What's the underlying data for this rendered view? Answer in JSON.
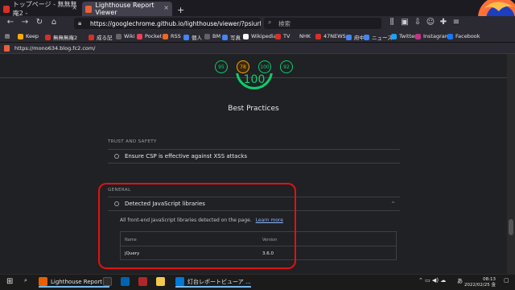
{
  "tabs": [
    {
      "label": "トップページ - 無無無庵2 -",
      "close": "×",
      "icon_color": "#d93025"
    },
    {
      "label": "Lighthouse Report Viewer",
      "close": "×",
      "icon_color": "#e8613c"
    }
  ],
  "new_tab": "+",
  "nav": {
    "back": "←",
    "forward": "→",
    "reload": "↻",
    "home": "⌂"
  },
  "address": {
    "url": "https://googlechrome.github.io/lighthouse/viewer/?psiurl=htt"
  },
  "search": {
    "placeholder": "検索"
  },
  "bookmarks": [
    {
      "label": "Keep",
      "color": "#f9ab00"
    },
    {
      "label": "無無無庵2",
      "color": "#d93025"
    },
    {
      "label": "成る記",
      "color": "#d93025"
    },
    {
      "label": "Wiki",
      "color": "#666666"
    },
    {
      "label": "Pocket",
      "color": "#ef4056"
    },
    {
      "label": "RSS",
      "color": "#f26522"
    },
    {
      "label": "個人",
      "color": "#4285f4"
    },
    {
      "label": "BM",
      "color": "#5f6368"
    },
    {
      "label": "写真",
      "color": "#4285f4"
    },
    {
      "label": "Wikipedia",
      "color": "#ffffff"
    },
    {
      "label": "TV",
      "color": "#d93025"
    },
    {
      "label": "NHK",
      "color": "#cccccc"
    },
    {
      "label": "47NEWS",
      "color": "#d93025"
    },
    {
      "label": "府中",
      "color": "#4285f4"
    },
    {
      "label": "ニュース",
      "color": "#4285f4"
    },
    {
      "label": "Twitter",
      "color": "#1da1f2"
    },
    {
      "label": "Instagram",
      "color": "#c13584"
    },
    {
      "label": "Facebook",
      "color": "#1877f2"
    }
  ],
  "site": {
    "url": "https://mono634.blog.fc2.com/"
  },
  "scores": [
    {
      "value": "95",
      "rating": "green"
    },
    {
      "value": "78",
      "rating": "orange"
    },
    {
      "value": "100",
      "rating": "green"
    },
    {
      "value": "92",
      "rating": "green"
    }
  ],
  "category": {
    "score": "100",
    "title": "Best Practices",
    "score_level": 1.0
  },
  "groups": {
    "trust": {
      "title": "TRUST AND SAFETY",
      "audit": "Ensure CSP is effective against XSS attacks"
    },
    "general": {
      "title": "GENERAL",
      "audit": "Detected JavaScript libraries",
      "chevron": "^",
      "description": "All front-end JavaScript libraries detected on the page.",
      "learn_more": "Learn more",
      "table": {
        "headers": [
          "Name",
          "Version"
        ],
        "rows": [
          [
            "jQuery",
            "3.6.0"
          ]
        ]
      }
    }
  },
  "taskbar": {
    "items": [
      {
        "label": "Lighthouse Report ...",
        "color": "#e66000"
      },
      {
        "label": "灯台レポートビューア ...",
        "color": "#0078d4"
      }
    ],
    "time": "08:13",
    "date": "2022/02/25 金",
    "lang": "あ"
  },
  "colors": {
    "pass": "#0cce6b",
    "average": "#ffa400",
    "highlight": "#e01212",
    "link": "#8ab4f8"
  }
}
